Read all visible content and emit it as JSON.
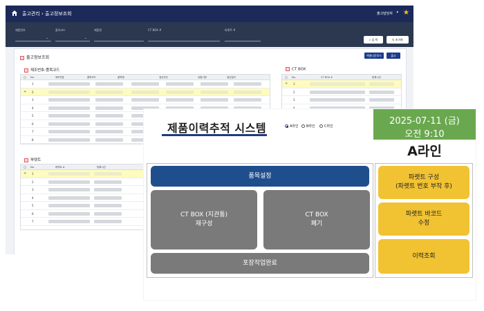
{
  "background": {
    "breadcrumb": "출고관리 › 출고정보조회",
    "user_label": "출고담당자",
    "filters": [
      "제품번호",
      "출하코드",
      "제품명",
      "CT BOX #",
      "파렛트 #"
    ],
    "search_button": "검 색",
    "reset_button": "초기화",
    "card_title": "출고정보조회",
    "excel_button": "엑셀다운로드",
    "ship_button": "출고",
    "section_product": "제조번호-품목코드",
    "section_ctbox": "CT BOX",
    "section_pallet": "파렛트",
    "product_grid_headers": [
      "No.",
      "제조번호",
      "품목코드",
      "품목명",
      "생산라인",
      "유통기한",
      "생산일자"
    ],
    "ctbox_grid_headers": [
      "No.",
      "CT BOX #",
      "등록시간"
    ],
    "pallet_grid_headers": [
      "No.",
      "파렛트 #",
      "등록시간"
    ],
    "row_numbers": [
      "1",
      "2",
      "3",
      "4",
      "5",
      "6",
      "7",
      "8"
    ]
  },
  "panel": {
    "title": "제품이력추적 시스템",
    "lines": [
      "A라인",
      "B라인",
      "C라인"
    ],
    "selected_line": "A라인",
    "date": "2025-07-11 (금)",
    "time": "오전 9:10",
    "current_line": "A라인",
    "buttons": {
      "item_settings": "품목설정",
      "ctbox_rebuild_1": "CT BOX (지관통)",
      "ctbox_rebuild_2": "재구성",
      "ctbox_discard_1": "CT BOX",
      "ctbox_discard_2": "폐기",
      "packing_complete": "포장작업완료",
      "pallet_build_1": "파렛트 구성",
      "pallet_build_2": "(파렛트 번호 부착 후)",
      "pallet_barcode_1": "파렛트 바코드",
      "pallet_barcode_2": "수정",
      "history_lookup": "이력조회"
    },
    "colors": {
      "primary_blue": "#1f4e8c",
      "gray": "#7a7a7a",
      "yellow": "#f1c232",
      "date_green": "#6aa84f"
    }
  }
}
